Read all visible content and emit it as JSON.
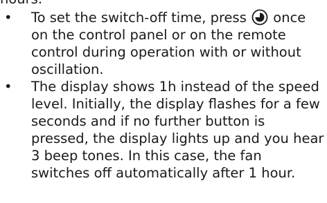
{
  "top_fragment": "hours.",
  "bullets": [
    {
      "text_before_icon": "To set the switch-off time, press ",
      "icon": "timer-icon",
      "text_after_icon": " once on the control panel or on the remote control during operation with or without oscillation."
    },
    {
      "text": "The display shows 1h instead of the speed level. Initially, the display flashes for a few seconds and if no further button is pressed, the display lights up and you hear 3 beep tones. In this case, the fan switches off automatically after 1 hour."
    }
  ],
  "bullet_symbol": "•"
}
